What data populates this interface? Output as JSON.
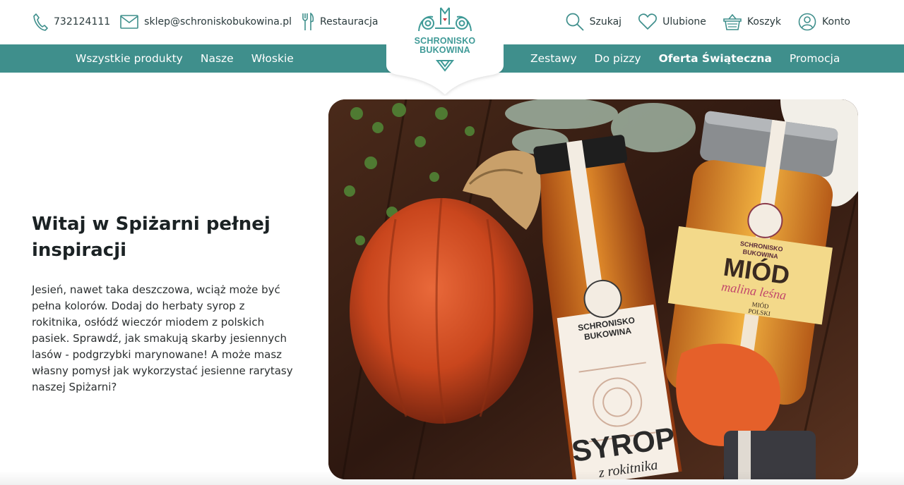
{
  "header": {
    "phone": "732124111",
    "email": "sklep@schroniskobukowina.pl",
    "restaurant": "Restauracja",
    "search": "Szukaj",
    "favorites": "Ulubione",
    "cart": "Koszyk",
    "account": "Konto"
  },
  "logo": {
    "line1": "SCHRONISKO",
    "line2": "BUKOWINA"
  },
  "nav": {
    "left": [
      "Wszystkie produkty",
      "Nasze",
      "Włoskie"
    ],
    "right": [
      "Zestawy",
      "Do pizzy",
      "Oferta Świąteczna",
      "Promocja"
    ]
  },
  "hero": {
    "title": "Witaj w Spiżarni pełnej inspiracji",
    "text": "Jesień, nawet taka deszczowa, wciąż może być pełna kolorów. Dodaj do herbaty syrop z rokitnika, osłódź wieczór miodem z polskich pasiek. Sprawdź, jak smakują skarby jesiennych lasów - podgrzybki marynowane! A może masz własny pomysł jak wykorzystać jesienne rarytasy naszej Spiżarni?"
  },
  "product_labels": {
    "syrup_brand_1": "SCHRONISKO",
    "syrup_brand_2": "BUKOWINA",
    "syrup_name": "SYROP",
    "syrup_sub": "z rokitnika",
    "honey_brand_1": "SCHRONISKO",
    "honey_brand_2": "BUKOWINA",
    "honey_name": "MIÓD",
    "honey_sub": "malina leśna",
    "honey_small_1": "MIÓD",
    "honey_small_2": "POLSKI"
  },
  "colors": {
    "accent": "#3f8f8c",
    "logo": "#3f9a97"
  }
}
